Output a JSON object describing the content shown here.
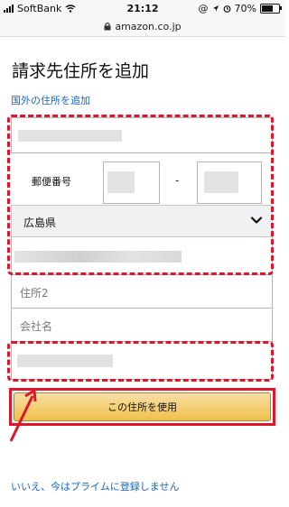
{
  "status_bar": {
    "carrier": "SoftBank",
    "time": "21:12",
    "battery": "70%",
    "icons": [
      "signal-icon",
      "wifi-icon",
      "at-icon",
      "location-icon",
      "alarm-icon",
      "bluetooth-icon",
      "battery-icon"
    ]
  },
  "browser": {
    "url": "amazon.co.jp",
    "icons": [
      "lock-icon"
    ]
  },
  "page": {
    "title": "請求先住所を追加",
    "international_link": "国外の住所を追加"
  },
  "form": {
    "zip_label": "郵便番号",
    "zip_separator": "-",
    "prefecture_selected": "広島県",
    "address2_placeholder": "住所2",
    "company_placeholder": "会社名",
    "submit_label": "この住所を使用"
  },
  "footer": {
    "decline_link": "いいえ、今はプライムに登録しません"
  },
  "colors": {
    "highlight": "#e0142b",
    "button": "#f0c14b",
    "link": "#1566c0"
  }
}
